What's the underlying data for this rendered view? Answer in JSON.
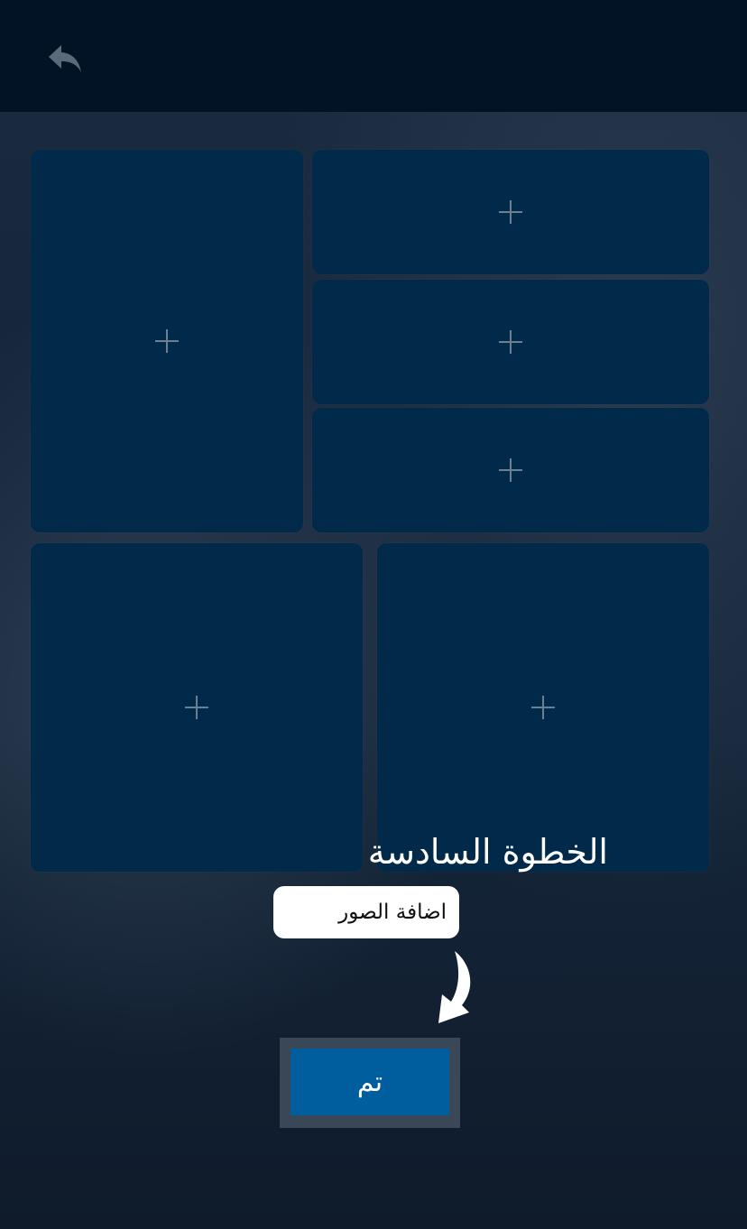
{
  "header": {
    "back_icon": "back-arrow-icon"
  },
  "collage": {
    "slot_icon": "plus-icon",
    "slots_count": 6
  },
  "step": {
    "title": "الخطوة السادسة",
    "hint": "اضافة الصور",
    "pointer_icon": "curved-arrow-icon"
  },
  "actions": {
    "done_label": "تم"
  },
  "colors": {
    "header_bg": "#011324",
    "tile_bg": "#012a4a",
    "done_bg": "#005e9e",
    "done_frame": "#3a4756"
  }
}
